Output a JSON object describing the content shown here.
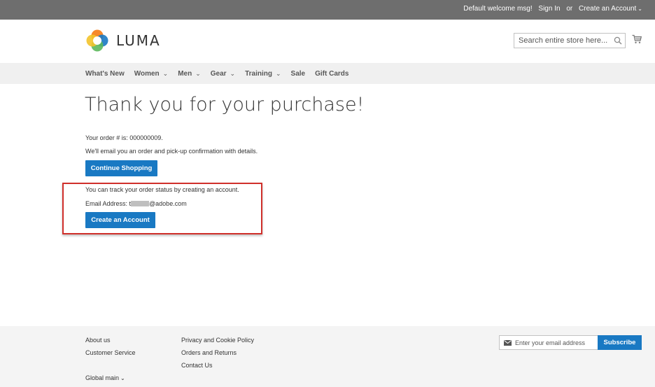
{
  "topbar": {
    "welcome": "Default welcome msg!",
    "sign_in": "Sign In",
    "or": "or",
    "create_account": "Create an Account"
  },
  "header": {
    "logo_text": "LUMA",
    "search_placeholder": "Search entire store here...",
    "search_value": ""
  },
  "nav": {
    "items": [
      {
        "label": "What's New",
        "dropdown": false
      },
      {
        "label": "Women",
        "dropdown": true
      },
      {
        "label": "Men",
        "dropdown": true
      },
      {
        "label": "Gear",
        "dropdown": true
      },
      {
        "label": "Training",
        "dropdown": true
      },
      {
        "label": "Sale",
        "dropdown": false
      },
      {
        "label": "Gift Cards",
        "dropdown": false
      }
    ]
  },
  "main": {
    "title": "Thank you for your purchase!",
    "order_number_text": "Your order # is: 000000009.",
    "confirmation_text": "We'll email you an order and pick-up confirmation with details.",
    "continue_button": "Continue Shopping",
    "track_text": "You can track your order status by creating an account.",
    "email_label": "Email Address: t",
    "email_domain": "@adobe.com",
    "create_account_button": "Create an Account"
  },
  "footer": {
    "col1": [
      "About us",
      "Customer Service"
    ],
    "col2": [
      "Privacy and Cookie Policy",
      "Orders and Returns",
      "Contact Us"
    ],
    "global_menu": "Global main",
    "newsletter_placeholder": "Enter your email address",
    "subscribe_button": "Subscribe"
  },
  "colors": {
    "topbar": "#6e6e6e",
    "nav_bg": "#f0f0f0",
    "primary_button": "#1979c3",
    "highlight_border": "#d0302b",
    "footer_bg": "#f4f4f4"
  },
  "icons": [
    "luma-logo-icon",
    "search-icon",
    "cart-icon",
    "chevron-down-icon",
    "mail-icon"
  ]
}
